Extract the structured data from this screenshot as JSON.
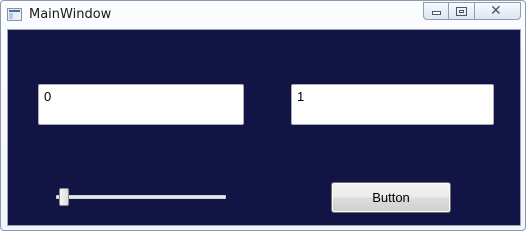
{
  "window": {
    "title": "MainWindow",
    "client_background": "#111444"
  },
  "controls": {
    "textbox_left_value": "0",
    "textbox_right_value": "1",
    "slider_value_fraction": 0.0,
    "button_label": "Button"
  },
  "icons": {
    "app": "window-icon",
    "minimize": "minimize-icon",
    "maximize": "maximize-icon",
    "close": "close-icon"
  }
}
